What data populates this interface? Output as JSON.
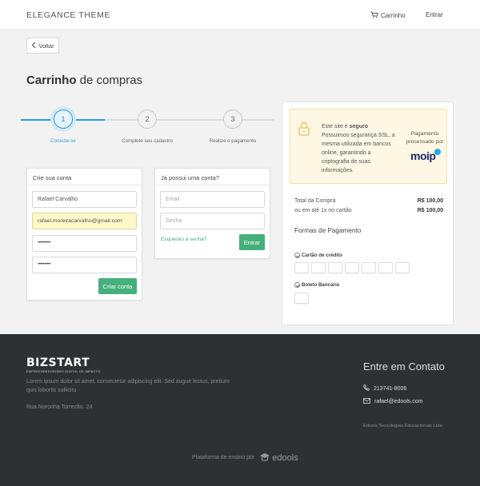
{
  "header": {
    "brand": "ELEGANCE THEME",
    "cart_label": "Carrinho",
    "login_label": "Entrar"
  },
  "back_label": "Voltar",
  "title": {
    "bold": "Carrinho",
    "rest": " de compras"
  },
  "steps": [
    {
      "number": "1",
      "label": "Conecte-se",
      "active": true
    },
    {
      "number": "2",
      "label": "Complete seu cadastro",
      "active": false
    },
    {
      "number": "3",
      "label": "Realize o pagamento",
      "active": false
    }
  ],
  "signup": {
    "heading": "Crie sua conta",
    "name_value": "Rafael Carvalho",
    "email_value": "rafael.moreiracarvalho@gmail.com",
    "password_value": "••••••••••",
    "password_confirm_value": "••••••••••",
    "submit_label": "Criar conta"
  },
  "login": {
    "heading": "Já possui uma conta?",
    "email_placeholder": "Email",
    "password_placeholder": "Senha",
    "forgot_label": "Esqueceu a senha?",
    "submit_label": "Entrar"
  },
  "secure": {
    "line1": "Este site é ",
    "line1_bold": "seguro",
    "rest": "Possuimos segurança SSL, a mesma utilizada em bancos online, garantindo a criptografia de suas informações.",
    "processed_by": "Pagamento processado por",
    "logo_text": "moip"
  },
  "summary": {
    "total_label": "Total da Compra",
    "total_value": "R$ 100,00",
    "installment_label": "ou em até 1x no cartão",
    "installment_value": "R$ 100,00"
  },
  "payment": {
    "title": "Formas de Pagamento",
    "credit_card_label": "Cartão de crédito",
    "boleto_label": "Boleto Bancário",
    "credit_card_slot_count": 7
  },
  "footer": {
    "logo_big": "BIZSTART",
    "logo_small": "EMPREENDEDORISMO DIGITAL DE IMPACTO",
    "description": "Lorem ipsum dolor sit amet, consectetur adipiscing elit. Sed augue lectus, pretium quis lobortis sollicitu",
    "address": "Rua Noronha Torrezão, 24",
    "contact_title": "Entre em Contato",
    "phone": "213741-8006",
    "email": "rafael@edools.com",
    "company": "Edools Tecnologias Educacionais Ltda",
    "powered_label": "Plataforma de ensino por",
    "powered_brand": "edools"
  },
  "colors": {
    "accent_blue": "#2a9de0",
    "button_green": "#45b07c",
    "footer_bg": "#2e3134",
    "secure_bg": "#fdf7e3"
  }
}
